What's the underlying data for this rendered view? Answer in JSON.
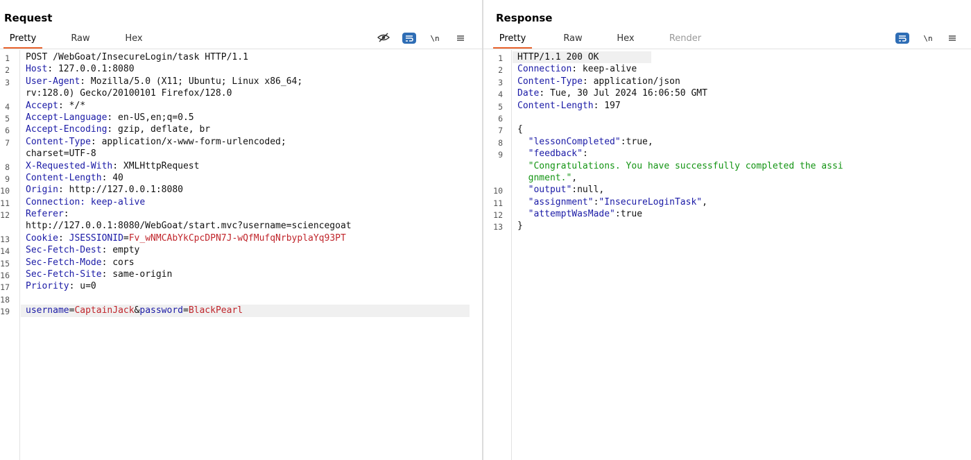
{
  "request": {
    "title": "Request",
    "tabs": [
      {
        "label": "Pretty",
        "active": true
      },
      {
        "label": "Raw",
        "active": false
      },
      {
        "label": "Hex",
        "active": false
      }
    ],
    "toolbar": {
      "newline": "\\n",
      "icons": [
        "eye-slash-icon",
        "wrap-lines-icon",
        "newline-icon",
        "menu-icon"
      ]
    },
    "lines": [
      {
        "n": "1",
        "parts": [
          {
            "t": "POST /WebGoat/InsecureLogin/task HTTP/1.1",
            "c": ""
          }
        ]
      },
      {
        "n": "2",
        "parts": [
          {
            "t": "Host",
            "c": "hk"
          },
          {
            "t": ": 127.0.0.1:8080",
            "c": ""
          }
        ]
      },
      {
        "n": "3",
        "parts": [
          {
            "t": "User-Agent",
            "c": "hk"
          },
          {
            "t": ": Mozilla/5.0 (X11; Ubuntu; Linux x86_64;",
            "c": ""
          }
        ]
      },
      {
        "n": "",
        "parts": [
          {
            "t": "rv:128.0) Gecko/20100101 Firefox/128.0",
            "c": ""
          }
        ]
      },
      {
        "n": "4",
        "parts": [
          {
            "t": "Accept",
            "c": "hk"
          },
          {
            "t": ": */*",
            "c": ""
          }
        ]
      },
      {
        "n": "5",
        "parts": [
          {
            "t": "Accept-Language",
            "c": "hk"
          },
          {
            "t": ": en-US,en;q=0.5",
            "c": ""
          }
        ]
      },
      {
        "n": "6",
        "parts": [
          {
            "t": "Accept-Encoding",
            "c": "hk"
          },
          {
            "t": ": gzip, deflate, br",
            "c": ""
          }
        ]
      },
      {
        "n": "7",
        "parts": [
          {
            "t": "Content-Type",
            "c": "hk"
          },
          {
            "t": ": application/x-www-form-urlencoded;",
            "c": ""
          }
        ]
      },
      {
        "n": "",
        "parts": [
          {
            "t": "charset=UTF-8",
            "c": ""
          }
        ]
      },
      {
        "n": "8",
        "parts": [
          {
            "t": "X-Requested-With",
            "c": "hk"
          },
          {
            "t": ": XMLHttpRequest",
            "c": ""
          }
        ]
      },
      {
        "n": "9",
        "parts": [
          {
            "t": "Content-Length",
            "c": "hk"
          },
          {
            "t": ": 40",
            "c": ""
          }
        ]
      },
      {
        "n": "10",
        "parts": [
          {
            "t": "Origin",
            "c": "hk"
          },
          {
            "t": ": http://127.0.0.1:8080",
            "c": ""
          }
        ]
      },
      {
        "n": "11",
        "parts": [
          {
            "t": "Connection: keep-alive",
            "c": "hk"
          }
        ]
      },
      {
        "n": "12",
        "parts": [
          {
            "t": "Referer",
            "c": "hk"
          },
          {
            "t": ":",
            "c": ""
          }
        ]
      },
      {
        "n": "",
        "parts": [
          {
            "t": "http://127.0.0.1:8080/WebGoat/start.mvc?username=sciencegoat",
            "c": ""
          }
        ]
      },
      {
        "n": "13",
        "parts": [
          {
            "t": "Cookie",
            "c": "hk"
          },
          {
            "t": ": ",
            "c": ""
          },
          {
            "t": "JSESSIONID",
            "c": "hk"
          },
          {
            "t": "=",
            "c": ""
          },
          {
            "t": "Fv_wNMCAbYkCpcDPN7J-wQfMufqNrbyplaYq93PT",
            "c": "pv"
          }
        ]
      },
      {
        "n": "14",
        "parts": [
          {
            "t": "Sec-Fetch-Dest",
            "c": "hk"
          },
          {
            "t": ": empty",
            "c": ""
          }
        ]
      },
      {
        "n": "15",
        "parts": [
          {
            "t": "Sec-Fetch-Mode",
            "c": "hk"
          },
          {
            "t": ": cors",
            "c": ""
          }
        ]
      },
      {
        "n": "16",
        "parts": [
          {
            "t": "Sec-Fetch-Site",
            "c": "hk"
          },
          {
            "t": ": same-origin",
            "c": ""
          }
        ]
      },
      {
        "n": "17",
        "parts": [
          {
            "t": "Priority",
            "c": "hk"
          },
          {
            "t": ": u=0",
            "c": ""
          }
        ]
      },
      {
        "n": "18",
        "parts": []
      },
      {
        "n": "19",
        "highlight": true,
        "parts": [
          {
            "t": "username",
            "c": "hk"
          },
          {
            "t": "=",
            "c": ""
          },
          {
            "t": "CaptainJack",
            "c": "pv"
          },
          {
            "t": "&",
            "c": ""
          },
          {
            "t": "password",
            "c": "hk"
          },
          {
            "t": "=",
            "c": ""
          },
          {
            "t": "BlackPearl",
            "c": "pv"
          }
        ]
      }
    ]
  },
  "response": {
    "title": "Response",
    "tabs": [
      {
        "label": "Pretty",
        "active": true
      },
      {
        "label": "Raw",
        "active": false
      },
      {
        "label": "Hex",
        "active": false
      },
      {
        "label": "Render",
        "active": false,
        "disabled": true
      }
    ],
    "toolbar": {
      "newline": "\\n",
      "icons": [
        "wrap-lines-icon",
        "newline-icon",
        "menu-icon"
      ]
    },
    "lines": [
      {
        "n": "1",
        "highlight": true,
        "parts": [
          {
            "t": "HTTP/1.1 200 OK",
            "c": ""
          }
        ]
      },
      {
        "n": "2",
        "parts": [
          {
            "t": "Connection",
            "c": "hk"
          },
          {
            "t": ": keep-alive",
            "c": ""
          }
        ]
      },
      {
        "n": "3",
        "parts": [
          {
            "t": "Content-Type",
            "c": "hk"
          },
          {
            "t": ": application/json",
            "c": ""
          }
        ]
      },
      {
        "n": "4",
        "parts": [
          {
            "t": "Date",
            "c": "hk"
          },
          {
            "t": ": Tue, 30 Jul 2024 16:06:50 GMT",
            "c": ""
          }
        ]
      },
      {
        "n": "5",
        "parts": [
          {
            "t": "Content-Length",
            "c": "hk"
          },
          {
            "t": ": 197",
            "c": ""
          }
        ]
      },
      {
        "n": "6",
        "parts": []
      },
      {
        "n": "7",
        "parts": [
          {
            "t": "{",
            "c": ""
          }
        ]
      },
      {
        "n": "8",
        "parts": [
          {
            "t": "  ",
            "c": ""
          },
          {
            "t": "\"lessonCompleted\"",
            "c": "jk"
          },
          {
            "t": ":true,",
            "c": ""
          }
        ]
      },
      {
        "n": "9",
        "parts": [
          {
            "t": "  ",
            "c": ""
          },
          {
            "t": "\"feedback\"",
            "c": "jk"
          },
          {
            "t": ":",
            "c": ""
          }
        ]
      },
      {
        "n": "",
        "parts": [
          {
            "t": "  ",
            "c": ""
          },
          {
            "t": "\"Congratulations. You have successfully completed the assi",
            "c": "js"
          }
        ]
      },
      {
        "n": "",
        "parts": [
          {
            "t": "  ",
            "c": ""
          },
          {
            "t": "gnment.\"",
            "c": "js"
          },
          {
            "t": ",",
            "c": ""
          }
        ]
      },
      {
        "n": "10",
        "parts": [
          {
            "t": "  ",
            "c": ""
          },
          {
            "t": "\"output\"",
            "c": "jk"
          },
          {
            "t": ":null,",
            "c": ""
          }
        ]
      },
      {
        "n": "11",
        "parts": [
          {
            "t": "  ",
            "c": ""
          },
          {
            "t": "\"assignment\"",
            "c": "jk"
          },
          {
            "t": ":",
            "c": ""
          },
          {
            "t": "\"InsecureLoginTask\"",
            "c": "jk"
          },
          {
            "t": ",",
            "c": ""
          }
        ]
      },
      {
        "n": "12",
        "parts": [
          {
            "t": "  ",
            "c": ""
          },
          {
            "t": "\"attemptWasMade\"",
            "c": "jk"
          },
          {
            "t": ":true",
            "c": ""
          }
        ]
      },
      {
        "n": "13",
        "parts": [
          {
            "t": "}",
            "c": ""
          }
        ]
      }
    ]
  },
  "view_toggle": {
    "options": [
      "split-view-icon",
      "horizontal-view-icon",
      "single-view-icon"
    ],
    "active": 0
  },
  "colors": {
    "accent": "#e8622c",
    "button": "#2e6db5",
    "header_key": "#1a1aa6",
    "param_value": "#c0252b",
    "json_string": "#139413"
  }
}
